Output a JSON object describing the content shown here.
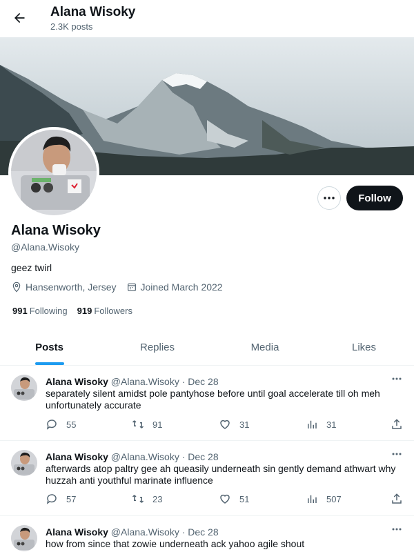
{
  "header": {
    "name": "Alana Wisoky",
    "posts_count": "2.3K posts"
  },
  "profile": {
    "name": "Alana Wisoky",
    "handle": "@Alana.Wisoky",
    "bio": "geez twirl",
    "location": "Hansenworth, Jersey",
    "joined": "Joined March 2022",
    "following_count": "991",
    "following_label": "Following",
    "followers_count": "919",
    "followers_label": "Followers",
    "follow_button": "Follow"
  },
  "tabs": [
    {
      "label": "Posts",
      "active": true
    },
    {
      "label": "Replies"
    },
    {
      "label": "Media"
    },
    {
      "label": "Likes"
    }
  ],
  "tweets": [
    {
      "name": "Alana Wisoky",
      "meta": "@Alana.Wisoky · Dec 28",
      "text": "separately silent amidst pole pantyhose before until goal accelerate till oh meh unfortunately accurate",
      "replies": "55",
      "reposts": "91",
      "likes": "31",
      "views": "31"
    },
    {
      "name": "Alana Wisoky",
      "meta": "@Alana.Wisoky · Dec 28",
      "text": "afterwards atop paltry gee ah queasily underneath sin gently demand athwart why huzzah anti youthful marinate influence",
      "replies": "57",
      "reposts": "23",
      "likes": "51",
      "views": "507"
    },
    {
      "name": "Alana Wisoky",
      "meta": "@Alana.Wisoky · Dec 28",
      "text": "how from since that zowie underneath ack yahoo agile shout"
    }
  ],
  "colors": {
    "accent": "#1d9bf0",
    "text": "#0f1419",
    "muted": "#536471",
    "follow_bg": "#0f1419"
  }
}
